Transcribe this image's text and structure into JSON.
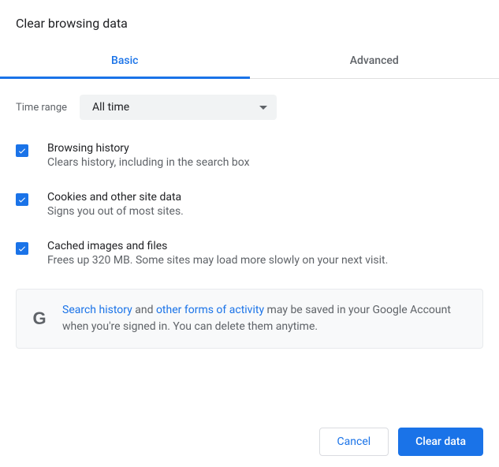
{
  "dialog": {
    "title": "Clear browsing data"
  },
  "tabs": {
    "basic": "Basic",
    "advanced": "Advanced"
  },
  "time_range": {
    "label": "Time range",
    "selected": "All time"
  },
  "options": [
    {
      "title": "Browsing history",
      "desc": "Clears history, including in the search box"
    },
    {
      "title": "Cookies and other site data",
      "desc": "Signs you out of most sites."
    },
    {
      "title": "Cached images and files",
      "desc": "Frees up 320 MB. Some sites may load more slowly on your next visit."
    }
  ],
  "info": {
    "link1": "Search history",
    "mid1": " and ",
    "link2": "other forms of activity",
    "rest": " may be saved in your Google Account when you're signed in. You can delete them anytime."
  },
  "buttons": {
    "cancel": "Cancel",
    "clear": "Clear data"
  }
}
